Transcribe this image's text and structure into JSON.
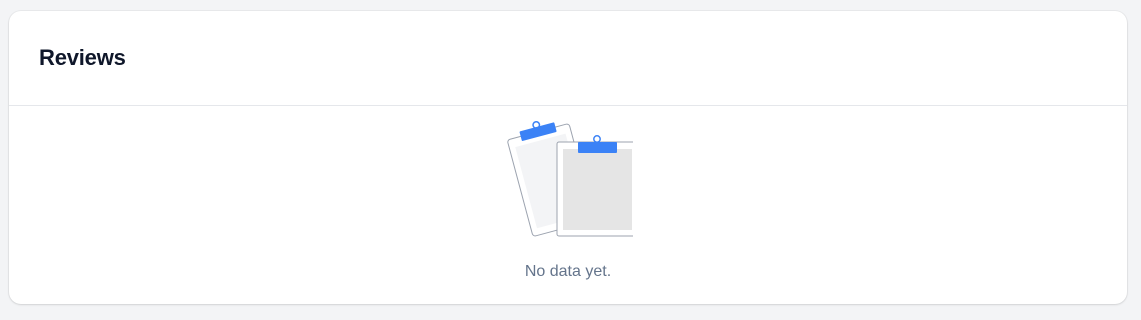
{
  "reviews_card": {
    "title": "Reviews",
    "empty_message": "No data yet.",
    "illustration_icon": "empty-clipboard-icon",
    "accent_color": "#3b82f6"
  }
}
